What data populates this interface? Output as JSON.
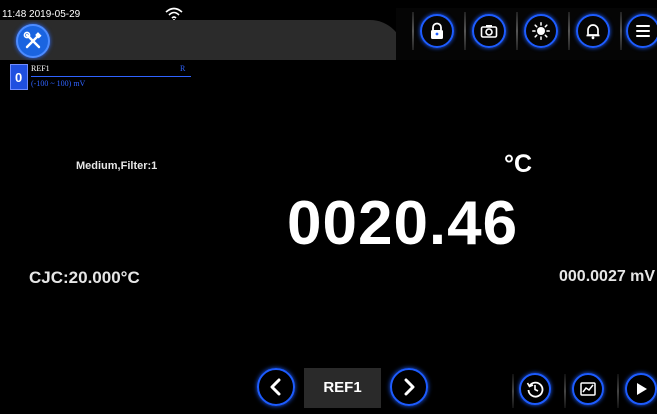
{
  "status": {
    "time": "11:48 2019-05-29"
  },
  "channel": {
    "number": "0",
    "name": "REF1",
    "flag": "R",
    "range": "(-100 ~ 100) mV"
  },
  "readings": {
    "filter": "Medium,Filter:1",
    "unit": "°C",
    "value": "0020.46",
    "cjc": "CJC:20.000°C",
    "millivolts": "000.0027 mV"
  },
  "bottom": {
    "ref_label": "REF1"
  },
  "icons": {
    "tools": "tools-icon",
    "lock": "lock-icon",
    "camera": "camera-icon",
    "brightness": "brightness-icon",
    "alarm": "bell-icon",
    "menu": "menu-icon",
    "prev": "chevron-left-icon",
    "next": "chevron-right-icon",
    "history": "history-icon",
    "chart": "chart-icon",
    "play": "play-icon"
  },
  "colors": {
    "accent": "#1d5cff",
    "background": "#000000",
    "text": "#ffffff"
  }
}
